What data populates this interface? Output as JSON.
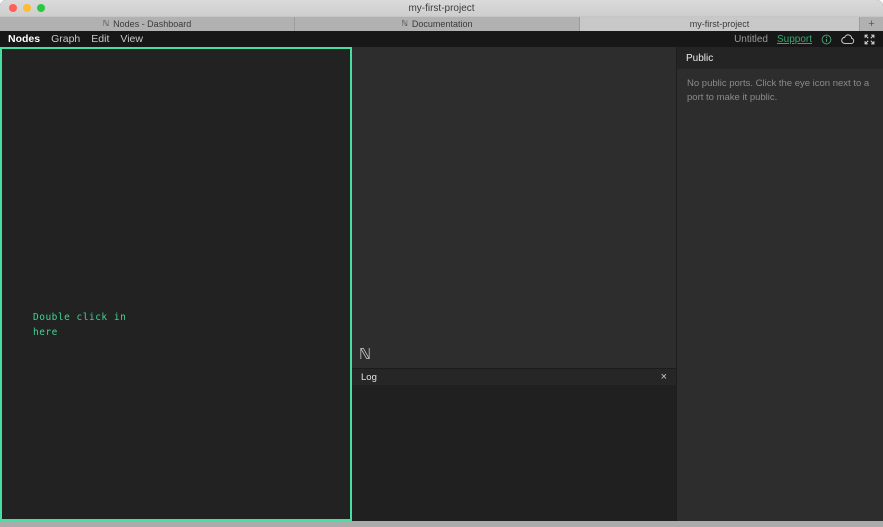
{
  "window": {
    "title": "my-first-project"
  },
  "browser_tabs": {
    "tabs": [
      {
        "favicon": "ℕ",
        "label": "Nodes - Dashboard"
      },
      {
        "favicon": "ℕ",
        "label": "Documentation"
      },
      {
        "favicon": "",
        "label": "my-first-project"
      }
    ],
    "new_tab_label": "+"
  },
  "menu_bar": {
    "menus": [
      {
        "label": "Nodes"
      },
      {
        "label": "Graph"
      },
      {
        "label": "Edit"
      },
      {
        "label": "View"
      }
    ],
    "right": {
      "document_name": "Untitled",
      "support_label": "Support",
      "icons": [
        "info-icon",
        "cloud-icon",
        "fullscreen-icon"
      ]
    }
  },
  "graph_canvas": {
    "hint_text": "Double click in\nhere"
  },
  "viewport": {
    "logo_glyph": "ℕ"
  },
  "log_panel": {
    "title": "Log",
    "close_glyph": "×"
  },
  "public_panel": {
    "title": "Public",
    "empty_message": "No public ports. Click the eye icon next to a port to make it public."
  },
  "colors": {
    "accent_green": "#45E0A1",
    "hint_text_green": "#3FD492",
    "support_link_green": "#36A86F"
  }
}
